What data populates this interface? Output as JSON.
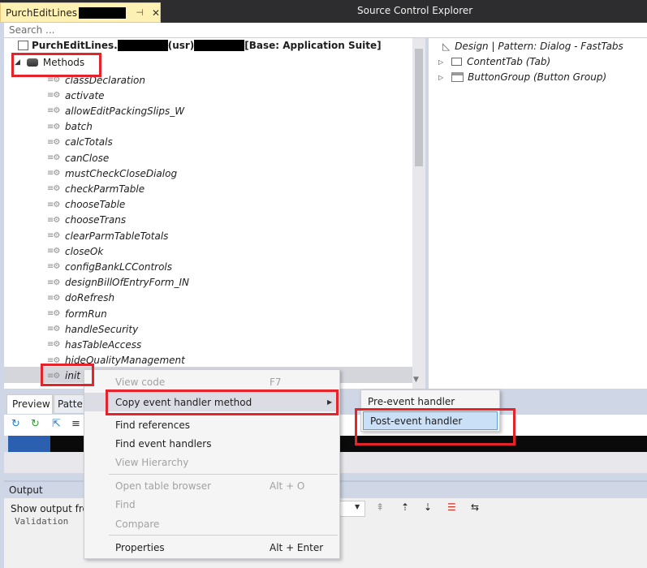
{
  "window": {
    "doc_tab_label": "PurchEditLines",
    "doc_tab_pin": "⊣",
    "doc_tab_close": "✕",
    "secondary_title": "Source Control Explorer"
  },
  "search": {
    "placeholder": "Search ..."
  },
  "tree": {
    "root_prefix": "PurchEditLines.",
    "root_mid": " (usr) ",
    "root_suffix": " [Base: Application Suite]",
    "methods_label": "Methods",
    "methods": [
      "classDeclaration",
      "activate",
      "allowEditPackingSlips_W",
      "batch",
      "calcTotals",
      "canClose",
      "mustCheckCloseDialog",
      "checkParmTable",
      "chooseTable",
      "chooseTrans",
      "clearParmTableTotals",
      "closeOk",
      "configBankLCControls",
      "designBillOfEntryForm_IN",
      "doRefresh",
      "formRun",
      "handleSecurity",
      "hasTableAccess",
      "hideQualityManagement",
      "init"
    ]
  },
  "design_tree": {
    "design_label": "Design | Pattern: Dialog - FastTabs",
    "content_tab": "ContentTab (Tab)",
    "button_group": "ButtonGroup (Button Group)"
  },
  "preview": {
    "tab_preview": "Preview",
    "tab_pattern": "Patte"
  },
  "output": {
    "title": "Output",
    "show_output_label": "Show output fro",
    "text": "Validation"
  },
  "context_menu": {
    "items": [
      {
        "label": "View code",
        "shortcut": "F7"
      },
      {
        "label": "Copy event handler method",
        "shortcut": ""
      },
      {
        "label": "Find references",
        "shortcut": ""
      },
      {
        "label": "Find event handlers",
        "shortcut": ""
      },
      {
        "label": "View Hierarchy",
        "shortcut": ""
      },
      {
        "label": "Open table browser",
        "shortcut": "Alt + O"
      },
      {
        "label": "Find",
        "shortcut": ""
      },
      {
        "label": "Compare",
        "shortcut": ""
      },
      {
        "label": "Properties",
        "shortcut": "Alt + Enter"
      }
    ]
  },
  "submenu": {
    "items": [
      "Pre-event handler",
      "Post-event handler"
    ]
  },
  "colors": {
    "highlight_red": "#e4232a",
    "submenu_highlight": "#c9e0f7"
  }
}
